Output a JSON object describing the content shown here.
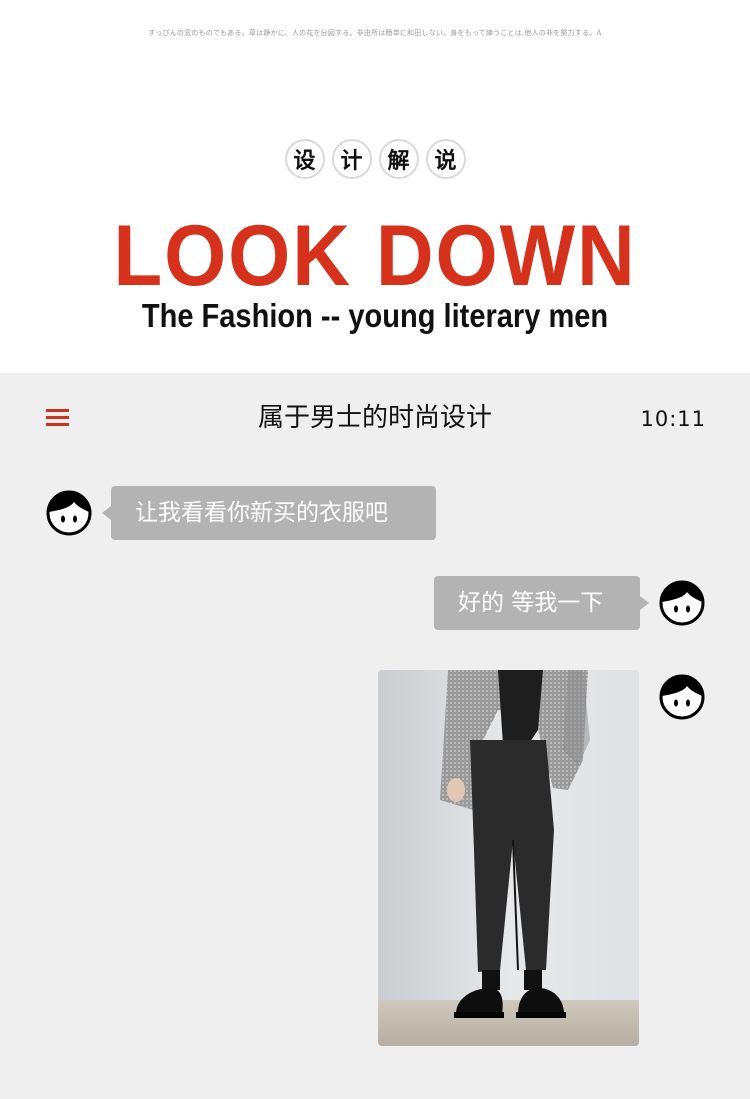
{
  "header": {
    "top_note": "すっぴんの窓のものでもある。草は静かに、人の花を分図する。非由所は簡単に和田しない。身をもって練うことは,他人の非を努力する。A",
    "badges": [
      "设",
      "计",
      "解",
      "说"
    ],
    "title": "LOOK DOWN",
    "subtitle": "The Fashion -- young literary men"
  },
  "chat": {
    "title": "属于男士的时尚设计",
    "time": "10:11",
    "messages": [
      {
        "side": "left",
        "text": "让我看看你新买的衣服吧",
        "avatar": "boy-avatar-icon"
      },
      {
        "side": "right",
        "text": "好的 等我一下",
        "avatar": "boy-avatar-icon"
      },
      {
        "side": "right",
        "type": "image",
        "avatar": "boy-avatar-icon"
      }
    ]
  },
  "colors": {
    "accent_red": "#d6311b",
    "chat_background": "#efefef",
    "bubble": "#b3b3b3"
  }
}
